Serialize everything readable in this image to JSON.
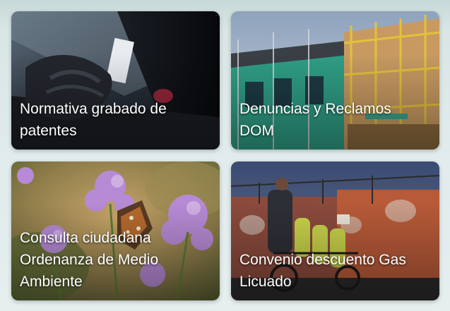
{
  "cards": [
    {
      "label": "Normativa grabado de\npatentes",
      "image": "car-theft-gloved-hand-image"
    },
    {
      "label": "Denuncias y Reclamos\nDOM",
      "image": "house-construction-scaffolding-image"
    },
    {
      "label": "Consulta ciudadana\nOrdenanza de Medio\nAmbiente",
      "image": "butterfly-on-flowers-image"
    },
    {
      "label": "Convenio descuento Gas\nLicuado",
      "image": "gas-cylinder-cart-vendor-image"
    }
  ]
}
